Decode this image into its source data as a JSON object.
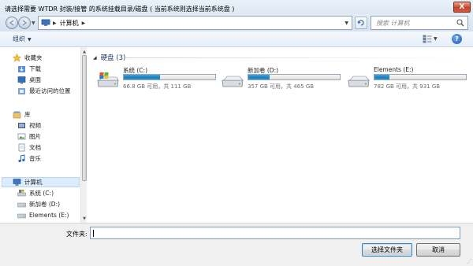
{
  "window": {
    "title": "请选择需要 WTDR 封装/接管 的系统挂载目录/磁盘 ( 当前系统则选择当前系统盘 )",
    "close_glyph": "X"
  },
  "address_bar": {
    "path": [
      "计算机"
    ],
    "search_placeholder": "搜索 计算机"
  },
  "toolbar": {
    "organize_label": "组织",
    "help_glyph": "?"
  },
  "nav_pane": {
    "favorites": {
      "label": "收藏夹",
      "items": [
        "下载",
        "桌面",
        "最近访问的位置"
      ]
    },
    "libraries": {
      "label": "库",
      "items": [
        "视频",
        "图片",
        "文档",
        "音乐"
      ]
    },
    "computer": {
      "label": "计算机",
      "items": [
        "系统 (C:)",
        "新加卷 (D:)",
        "Elements (E:)"
      ]
    }
  },
  "content": {
    "group_title": "硬盘 (3)",
    "drives": [
      {
        "name": "系统 (C:)",
        "free_text": "66.8 GB 可用，共 111 GB",
        "used_fraction": 0.4,
        "icon": "windows-drive-icon"
      },
      {
        "name": "新加卷 (D:)",
        "free_text": "357 GB 可用，共 465 GB",
        "used_fraction": 0.23,
        "icon": "hard-drive-icon"
      },
      {
        "name": "Elements (E:)",
        "free_text": "782 GB 可用，共 931 GB",
        "used_fraction": 0.16,
        "icon": "hard-drive-icon"
      }
    ]
  },
  "bottom": {
    "filename_label": "文件夹:",
    "filename_value": "",
    "select_button": "选择文件夹",
    "cancel_button": "取消"
  },
  "colors": {
    "drive_fill": "#1a7fbf",
    "selected_nav": "#dcecfc"
  }
}
